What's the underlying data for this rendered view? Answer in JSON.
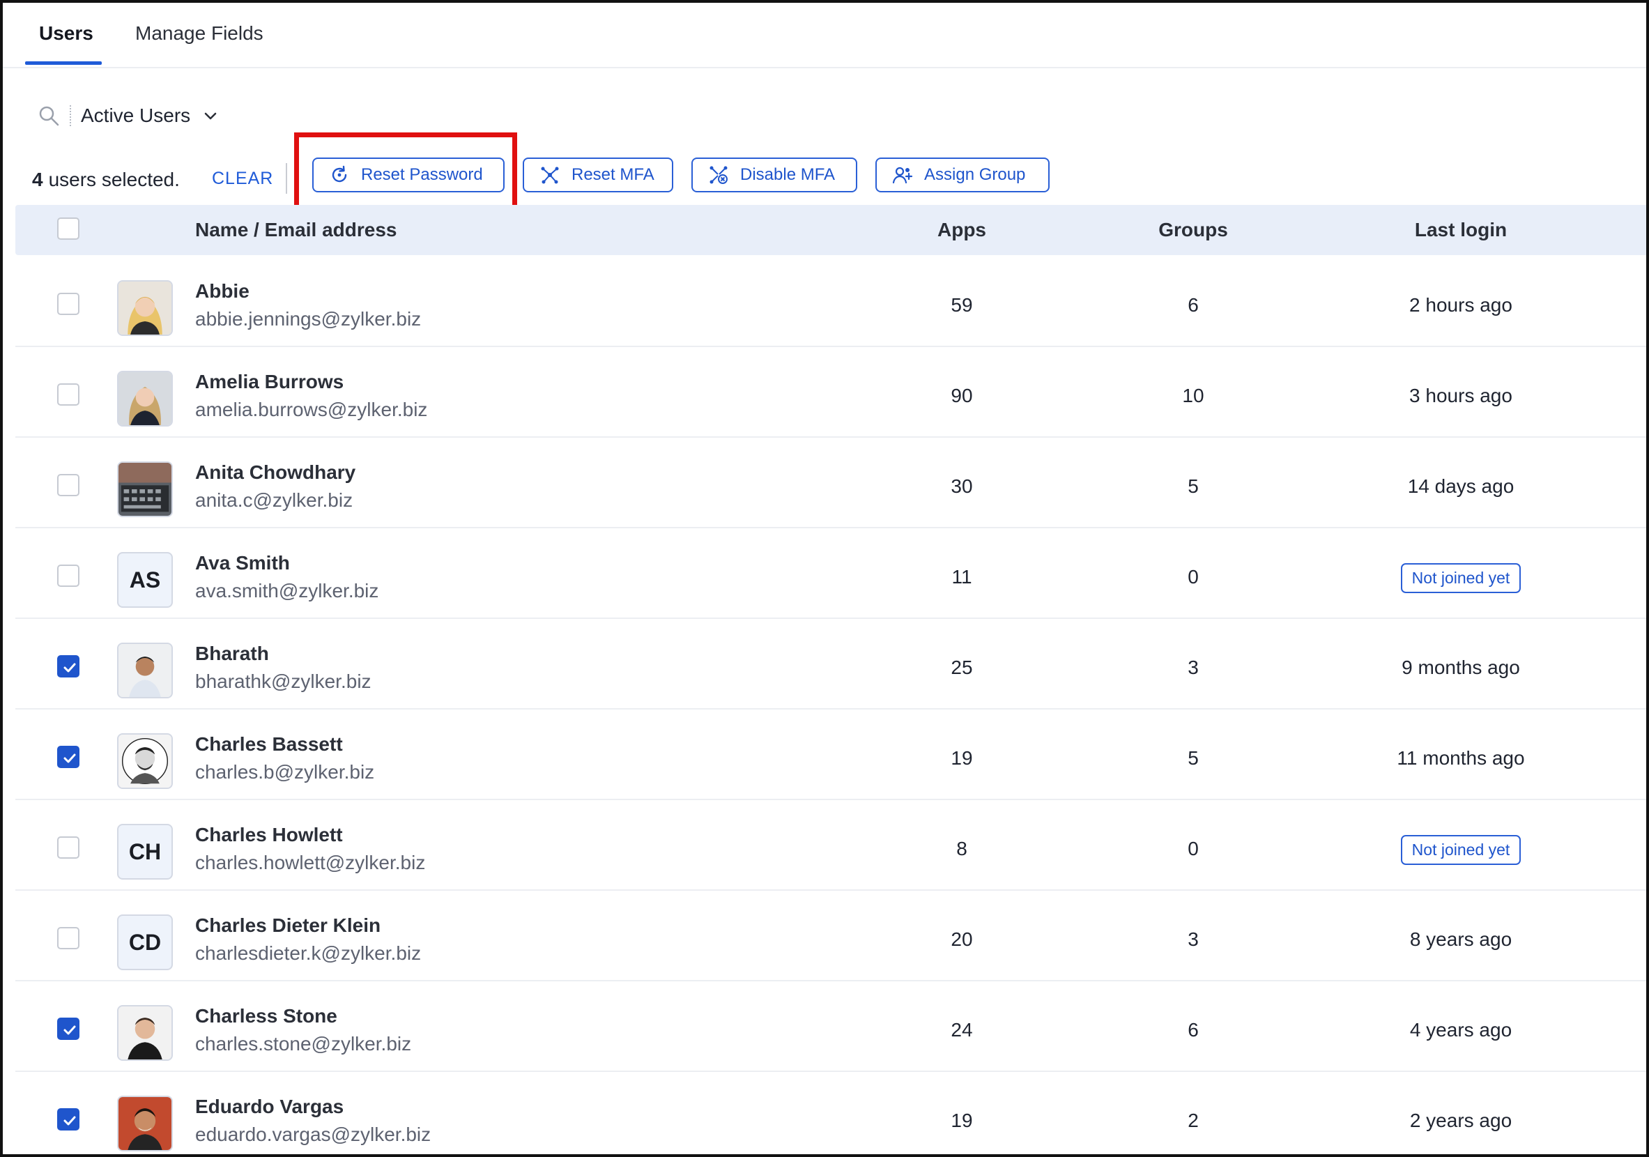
{
  "tabs": [
    {
      "label": "Users",
      "active": true
    },
    {
      "label": "Manage Fields",
      "active": false
    }
  ],
  "filter": {
    "label": "Active Users"
  },
  "selection": {
    "count": "4",
    "text": "users selected.",
    "clear_label": "CLEAR"
  },
  "actions": {
    "reset_password": "Reset Password",
    "reset_mfa": "Reset MFA",
    "disable_mfa": "Disable MFA",
    "assign_group": "Assign Group"
  },
  "table": {
    "headers": {
      "name": "Name / Email address",
      "apps": "Apps",
      "groups": "Groups",
      "last_login": "Last login"
    },
    "rows": [
      {
        "name": "Abbie",
        "email": "abbie.jennings@zylker.biz",
        "apps": "59",
        "groups": "6",
        "last_login": "2 hours ago",
        "checked": false,
        "avatar": "photo",
        "initials": ""
      },
      {
        "name": "Amelia Burrows",
        "email": "amelia.burrows@zylker.biz",
        "apps": "90",
        "groups": "10",
        "last_login": "3 hours ago",
        "checked": false,
        "avatar": "photo",
        "initials": ""
      },
      {
        "name": "Anita Chowdhary",
        "email": "anita.c@zylker.biz",
        "apps": "30",
        "groups": "5",
        "last_login": "14 days ago",
        "checked": false,
        "avatar": "photo",
        "initials": ""
      },
      {
        "name": "Ava Smith",
        "email": "ava.smith@zylker.biz",
        "apps": "11",
        "groups": "0",
        "last_login": "Not joined yet",
        "checked": false,
        "avatar": "initials",
        "initials": "AS"
      },
      {
        "name": "Bharath",
        "email": "bharathk@zylker.biz",
        "apps": "25",
        "groups": "3",
        "last_login": "9 months ago",
        "checked": true,
        "avatar": "photo",
        "initials": ""
      },
      {
        "name": "Charles Bassett",
        "email": "charles.b@zylker.biz",
        "apps": "19",
        "groups": "5",
        "last_login": "11 months ago",
        "checked": true,
        "avatar": "photo",
        "initials": ""
      },
      {
        "name": "Charles Howlett",
        "email": "charles.howlett@zylker.biz",
        "apps": "8",
        "groups": "0",
        "last_login": "Not joined yet",
        "checked": false,
        "avatar": "initials",
        "initials": "CH"
      },
      {
        "name": "Charles Dieter Klein",
        "email": "charlesdieter.k@zylker.biz",
        "apps": "20",
        "groups": "3",
        "last_login": "8 years ago",
        "checked": false,
        "avatar": "initials",
        "initials": "CD"
      },
      {
        "name": "Charless Stone",
        "email": "charles.stone@zylker.biz",
        "apps": "24",
        "groups": "6",
        "last_login": "4 years ago",
        "checked": true,
        "avatar": "photo",
        "initials": ""
      },
      {
        "name": "Eduardo Vargas",
        "email": "eduardo.vargas@zylker.biz",
        "apps": "19",
        "groups": "2",
        "last_login": "2 years ago",
        "checked": true,
        "avatar": "photo",
        "initials": ""
      }
    ]
  },
  "colors": {
    "accent": "#1f55cc",
    "highlight": "#e01010",
    "header_bg": "#e8eef9"
  },
  "icons": [
    "search-icon",
    "chevron-down-icon",
    "reset-password-icon",
    "reset-mfa-icon",
    "disable-mfa-icon",
    "assign-group-icon",
    "checkmark-icon"
  ]
}
